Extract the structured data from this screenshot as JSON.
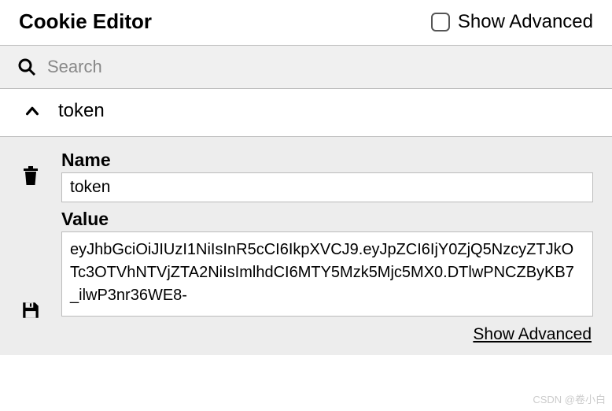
{
  "header": {
    "title": "Cookie Editor",
    "show_advanced_label": "Show Advanced"
  },
  "search": {
    "placeholder": "Search"
  },
  "cookie": {
    "display_name": "token",
    "name_label": "Name",
    "name_value": "token",
    "value_label": "Value",
    "value_value": "eyJhbGciOiJIUzI1NiIsInR5cCI6IkpXVCJ9.eyJpZCI6IjY0ZjQ5NzcyZTJkOTc3OTVhNTVjZTA2NiIsImlhdCI6MTY5Mzk5Mjc5MX0.DTlwPNCZByKB7_ilwP3nr36WE8-",
    "show_advanced_link": "Show Advanced"
  },
  "watermark": "CSDN @卷小白"
}
